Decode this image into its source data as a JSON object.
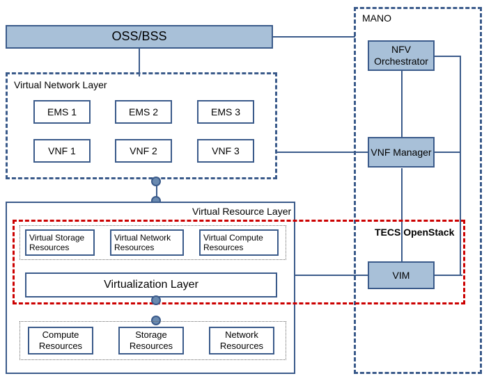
{
  "oss_bss": "OSS/BSS",
  "mano_label": "MANO",
  "vnl_label": "Virtual  Network Layer",
  "ems": [
    "EMS 1",
    "EMS 2",
    "EMS 3"
  ],
  "vnf": [
    "VNF 1",
    "VNF 2",
    "VNF 3"
  ],
  "vrl_label": "Virtual Resource Layer",
  "virt_res": [
    "Virtual Storage Resources",
    "Virtual Network Resources",
    "Virtual Compute Resources"
  ],
  "virt_layer": "Virtualization Layer",
  "hw_res": [
    "Compute Resources",
    "Storage Resources",
    "Network Resources"
  ],
  "nfv_orch": "NFV Orchestrator",
  "vnf_mgr": "VNF Manager",
  "vim": "VIM",
  "tecs": "TECS OpenStack"
}
